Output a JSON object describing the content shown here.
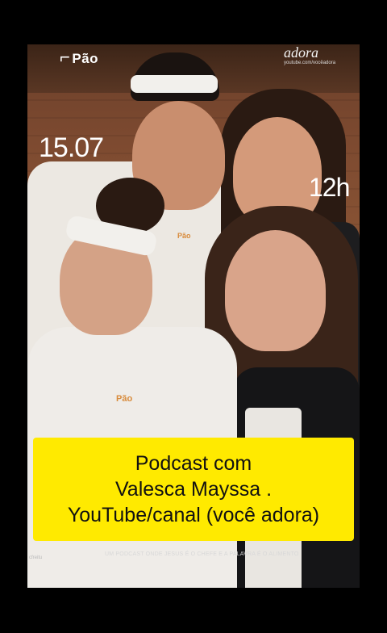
{
  "poster": {
    "logo_left": "Pão",
    "logo_right": "adora",
    "logo_right_sub": "youtube.com/vocêadora",
    "date": "15.07",
    "time": "12h",
    "badge_text": "Pão",
    "footer": "UM PODCAST ONDE JESUS É O CHEFE E A PALAVRA É O ALIMENTO",
    "side_small": "cfreitu"
  },
  "caption": {
    "line1": "Podcast com",
    "line2": "Valesca Mayssa .",
    "line3": "YouTube/canal (você adora)",
    "background": "#ffea00"
  }
}
